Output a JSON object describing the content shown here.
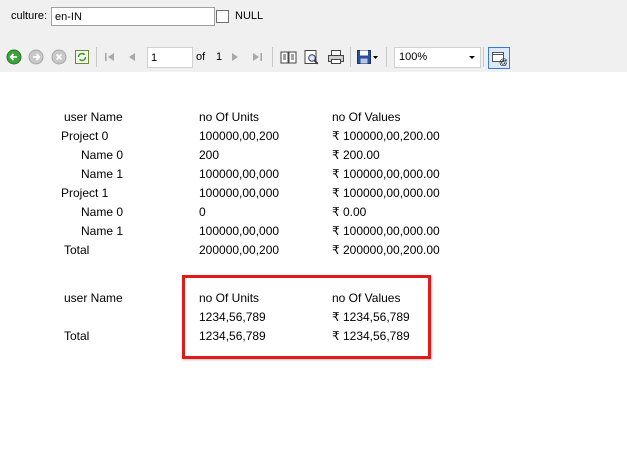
{
  "params": {
    "culture_label": "culture:",
    "culture_value": "en-IN",
    "null_label": "NULL"
  },
  "toolbar": {
    "page_value": "1",
    "of_label": "of",
    "total_pages": "1",
    "zoom_value": "100%",
    "icons": [
      "back-icon",
      "forward-icon",
      "stop-icon",
      "refresh-icon",
      "first-page-icon",
      "previous-page-icon",
      "next-page-icon",
      "last-page-icon",
      "document-map-icon",
      "print-layout-icon",
      "print-icon",
      "export-icon",
      "email-icon"
    ]
  },
  "report": {
    "table1": {
      "headers": [
        "user Name",
        "no Of Units",
        "no Of Values"
      ],
      "rows": [
        {
          "name": "Project 0",
          "units": "100000,00,200",
          "values": "₹ 100000,00,200.00"
        },
        {
          "name": "Name 0",
          "units": "200",
          "values": "₹ 200.00"
        },
        {
          "name": "Name 1",
          "units": "100000,00,000",
          "values": "₹ 100000,00,000.00"
        },
        {
          "name": "Project 1",
          "units": "100000,00,000",
          "values": "₹ 100000,00,000.00"
        },
        {
          "name": "Name 0",
          "units": "0",
          "values": "₹ 0.00"
        },
        {
          "name": "Name 1",
          "units": "100000,00,000",
          "values": "₹ 100000,00,000.00"
        },
        {
          "name": "Total",
          "units": "200000,00,200",
          "values": "₹ 200000,00,200.00"
        }
      ]
    },
    "table2": {
      "headers": [
        "user Name",
        "no Of Units",
        "no Of Values"
      ],
      "rows": [
        {
          "name": "",
          "units": "1234,56,789",
          "values": "₹ 1234,56,789"
        },
        {
          "name": "Total",
          "units": "1234,56,789",
          "values": "₹ 1234,56,789"
        }
      ]
    }
  },
  "colors": {
    "highlight": "#e01919",
    "toolbar_bg": "#f0f0f0"
  }
}
